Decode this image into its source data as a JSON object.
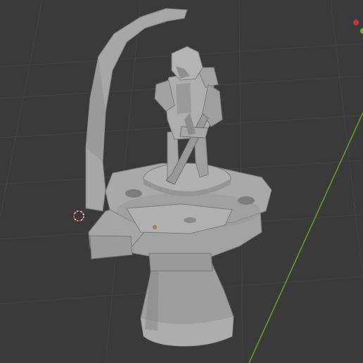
{
  "viewport": {
    "background": "#3a3a3a",
    "grid_color": "#434343",
    "grid_color_major": "#4a4a4a"
  },
  "axes": {
    "y_axis_color": "#5fa12b",
    "x_axis_gizmo_color": "#c7323b",
    "y_axis_gizmo_color": "#6fb02b"
  },
  "scene": {
    "model_color": "#a9a9a9",
    "model_shadow": "#7e7e7e",
    "model_highlight": "#c4c4c4",
    "cursor_icon": "3d-cursor-icon",
    "origin_icon": "object-origin-icon"
  }
}
